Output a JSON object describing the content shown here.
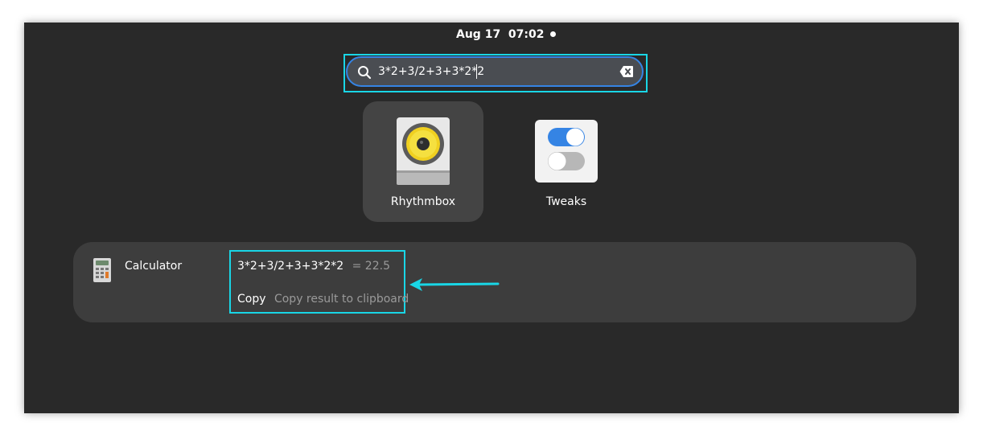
{
  "topbar": {
    "clock": "Aug 17  07:02"
  },
  "search": {
    "value": "3*2+3/2+3+3*2*2",
    "icon": "search-icon",
    "clear_icon": "edit-clear-icon"
  },
  "apps": [
    {
      "name": "Rhythmbox",
      "icon": "rhythmbox-icon",
      "selected": true
    },
    {
      "name": "Tweaks",
      "icon": "tweaks-icon",
      "selected": false
    }
  ],
  "result": {
    "provider": "Calculator",
    "expression": "3*2+3/2+3+3*2*2",
    "answer": "= 22.5",
    "action_label": "Copy",
    "action_description": "Copy result to clipboard"
  },
  "colors": {
    "background": "#292929",
    "accent_blue": "#3584e4",
    "highlight_cyan": "#19d6e6",
    "panel": "#3d3d3d",
    "tile_selected": "#444444"
  }
}
